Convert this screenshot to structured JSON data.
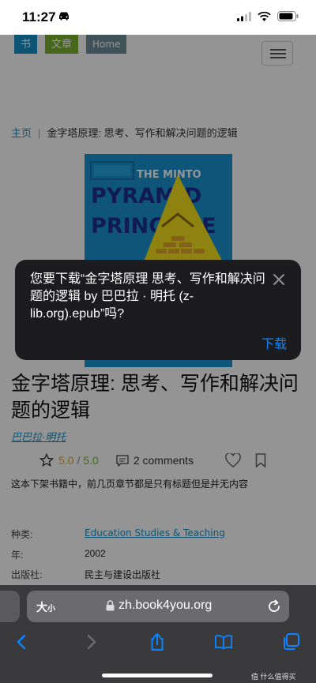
{
  "status_bar": {
    "time": "11:27"
  },
  "nav": {
    "tag_book": "书",
    "tag_article": "文章",
    "tag_home": "Home"
  },
  "breadcrumb": {
    "home": "主页",
    "separator": "|",
    "current": "金字塔原理: 思考、写作和解决问题的逻辑"
  },
  "book": {
    "title": "金字塔原理: 思考、写作和解决问题的逻辑",
    "author": "巴巴拉·明托",
    "rating": "5.0",
    "rating_sep": "/",
    "rating_max": "5.0",
    "comments": "2 comments",
    "description": "这本下架书籍中，前几页章节都是只有标题但是并无内容",
    "cover_text": [
      "THE MINTO",
      "PYRAMID",
      "PRINCIPLE"
    ]
  },
  "meta": [
    {
      "label": "种类:",
      "value": "Education Studies & Teaching",
      "link": true
    },
    {
      "label": "年:",
      "value": "2002",
      "link": false
    },
    {
      "label": "出版社:",
      "value": "民主与建设出版社",
      "link": false
    }
  ],
  "dialog": {
    "message": "您要下载“金字塔原理 思考、写作和解决问题的逻辑 by 巴巴拉 · 明托 (z-lib.org).epub”吗?",
    "download_label": "下载"
  },
  "safari": {
    "text_size_big": "大",
    "text_size_small": "小",
    "url": "zh.book4you.org"
  },
  "watermark": "值 什么值得买",
  "colors": {
    "accent": "#0a84ff",
    "link": "#1b8fc4",
    "star": "#e3a72a",
    "green": "#7ab32e"
  }
}
